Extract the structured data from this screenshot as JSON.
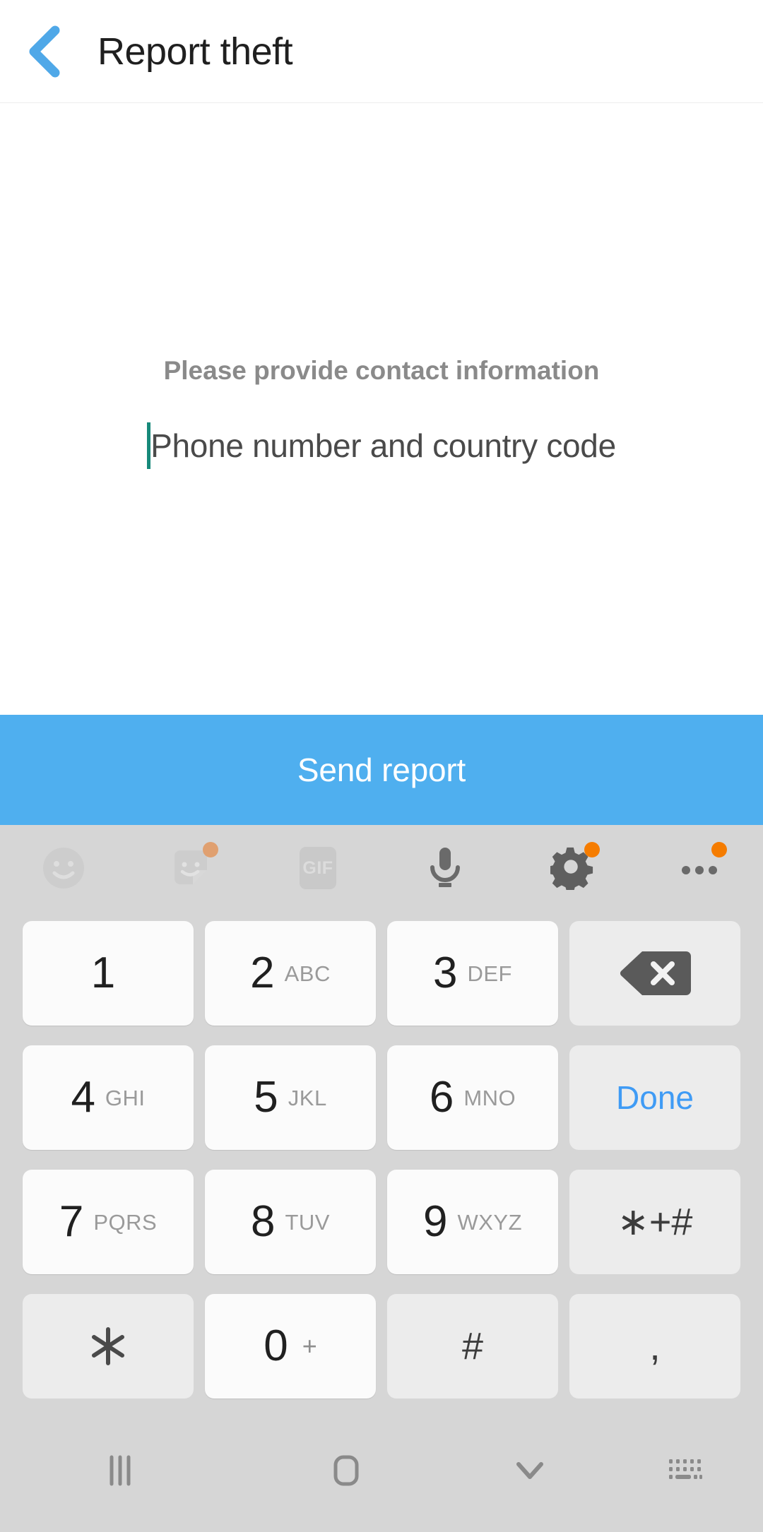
{
  "header": {
    "title": "Report theft",
    "back_icon": "back-chevron-icon",
    "back_color": "#4FA8E8"
  },
  "form": {
    "label": "Please provide contact information",
    "input_placeholder": "Phone number and country code",
    "input_value": "",
    "caret_color": "#17897a"
  },
  "primary_action": {
    "label": "Send report",
    "background": "#4FAFEF",
    "text_color": "#ffffff"
  },
  "keyboard": {
    "background": "#d6d6d6",
    "toolbar": [
      {
        "name": "emoji-icon",
        "label": "",
        "badge": false,
        "state": "disabled"
      },
      {
        "name": "sticker-icon",
        "label": "",
        "badge": true,
        "state": "disabled"
      },
      {
        "name": "gif-icon",
        "label": "GIF",
        "badge": false,
        "state": "disabled"
      },
      {
        "name": "microphone-icon",
        "label": "",
        "badge": false,
        "state": "enabled"
      },
      {
        "name": "settings-gear-icon",
        "label": "",
        "badge": true,
        "state": "enabled"
      },
      {
        "name": "more-options-icon",
        "label": "",
        "badge": true,
        "state": "enabled"
      }
    ],
    "badge_color": "#F57C00",
    "rows": [
      [
        {
          "type": "digit",
          "digit": "1",
          "letters": "",
          "style": "white"
        },
        {
          "type": "digit",
          "digit": "2",
          "letters": "ABC",
          "style": "white"
        },
        {
          "type": "digit",
          "digit": "3",
          "letters": "DEF",
          "style": "white"
        },
        {
          "type": "backspace",
          "digit": "",
          "letters": "",
          "style": "gray"
        }
      ],
      [
        {
          "type": "digit",
          "digit": "4",
          "letters": "GHI",
          "style": "white"
        },
        {
          "type": "digit",
          "digit": "5",
          "letters": "JKL",
          "style": "white"
        },
        {
          "type": "digit",
          "digit": "6",
          "letters": "MNO",
          "style": "white"
        },
        {
          "type": "done",
          "digit": "Done",
          "letters": "",
          "style": "gray"
        }
      ],
      [
        {
          "type": "digit",
          "digit": "7",
          "letters": "PQRS",
          "style": "white"
        },
        {
          "type": "digit",
          "digit": "8",
          "letters": "TUV",
          "style": "white"
        },
        {
          "type": "digit",
          "digit": "9",
          "letters": "WXYZ",
          "style": "white"
        },
        {
          "type": "symbol",
          "digit": "∗+#",
          "letters": "",
          "style": "gray"
        }
      ],
      [
        {
          "type": "symbol",
          "digit": "✳",
          "letters": "",
          "style": "gray"
        },
        {
          "type": "zero",
          "digit": "0",
          "letters": "+",
          "style": "white"
        },
        {
          "type": "symbol",
          "digit": "#",
          "letters": "",
          "style": "gray"
        },
        {
          "type": "comma",
          "digit": ",",
          "letters": "",
          "style": "gray"
        }
      ]
    ],
    "done_color": "#3F9BF5"
  },
  "nav_bar": [
    {
      "name": "recents-icon"
    },
    {
      "name": "home-icon"
    },
    {
      "name": "hide-keyboard-icon"
    },
    {
      "name": "switch-keyboard-icon"
    }
  ]
}
